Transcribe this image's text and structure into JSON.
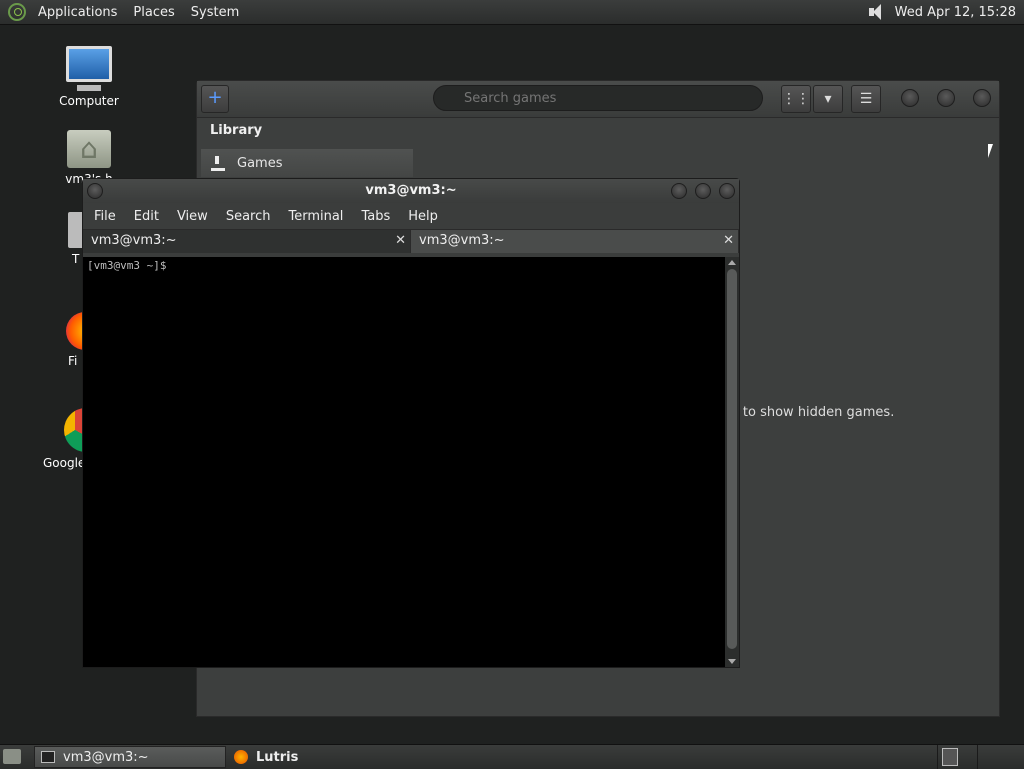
{
  "top_panel": {
    "menus": [
      "Applications",
      "Places",
      "System"
    ],
    "clock": "Wed Apr 12, 15:28"
  },
  "desktop": {
    "icons": [
      "Computer",
      "vm3's h",
      "T",
      "Fi",
      "Google"
    ]
  },
  "lutris": {
    "search_placeholder": "Search games",
    "sidebar_title": "Library",
    "sidebar_item": "Games",
    "hidden_message": "H to show hidden games."
  },
  "terminal": {
    "title": "vm3@vm3:~",
    "menus": [
      "File",
      "Edit",
      "View",
      "Search",
      "Terminal",
      "Tabs",
      "Help"
    ],
    "tabs": [
      "vm3@vm3:~",
      "vm3@vm3:~"
    ],
    "prompt": "[vm3@vm3 ~]$"
  },
  "bottom_panel": {
    "tasks": [
      "vm3@vm3:~",
      "Lutris"
    ]
  },
  "colors": {
    "desktop_bg": "#1f2120",
    "panel_bg": "#2f3130",
    "accent_blue": "#5b9bff"
  },
  "icons": {
    "add": "plus-icon",
    "search": "search-icon",
    "grid_view": "grid-icon",
    "dropdown": "chevron-down-icon",
    "menu": "hamburger-icon"
  }
}
